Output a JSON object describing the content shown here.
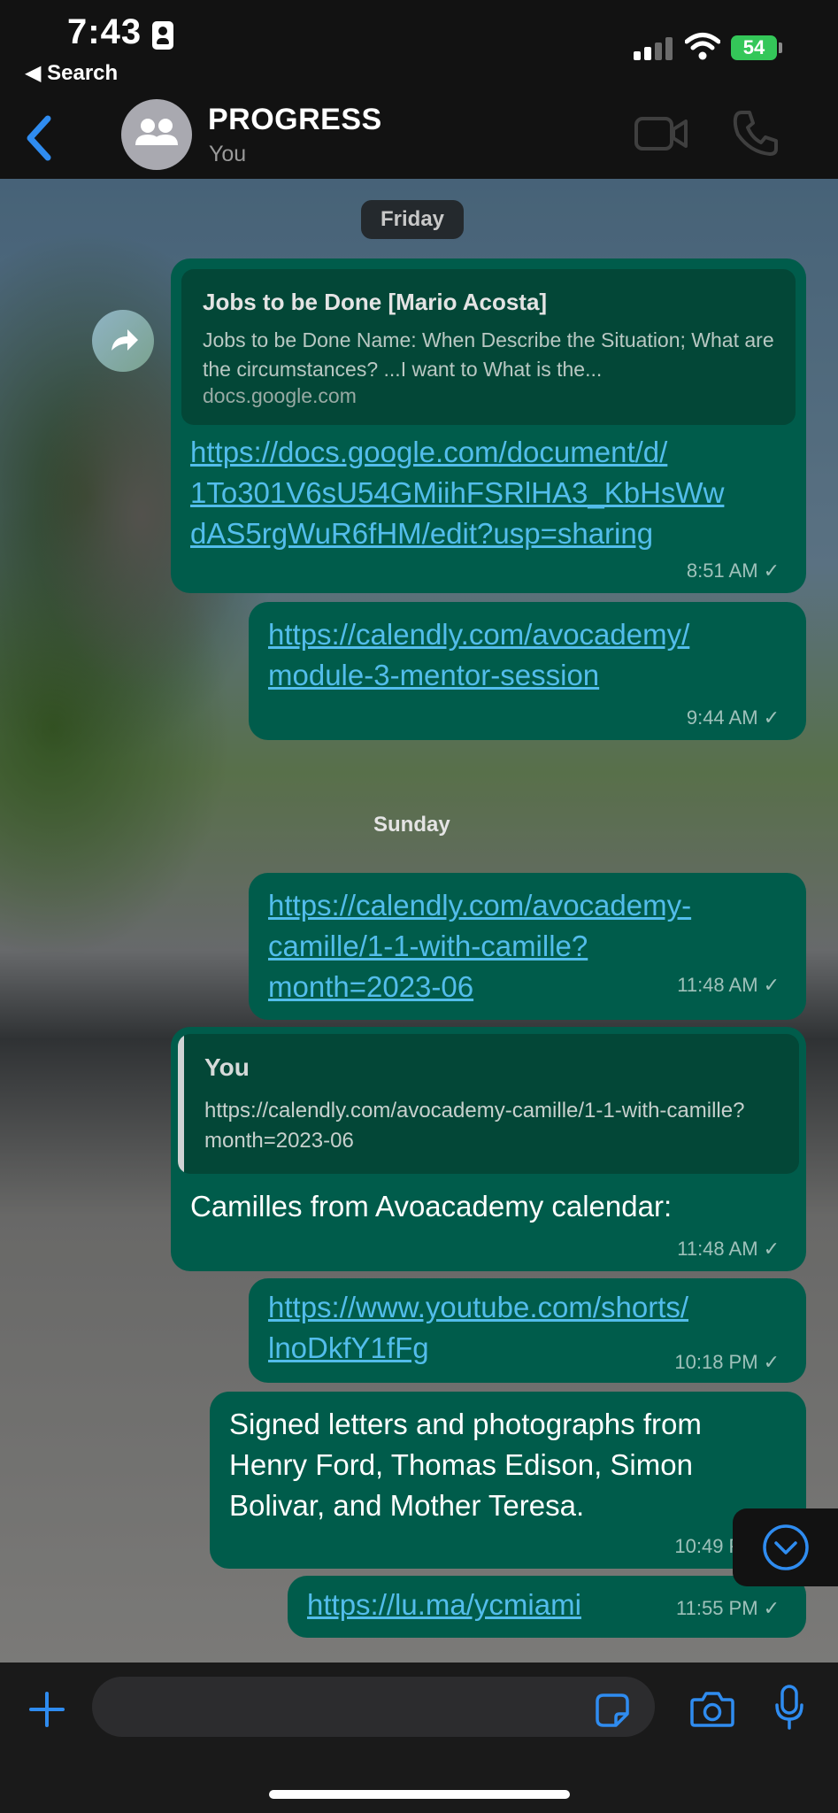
{
  "status_bar": {
    "time": "7:43",
    "back_app": "◀ Search",
    "battery": "54"
  },
  "header": {
    "title": "PROGRESS",
    "subtitle": "You"
  },
  "chat": {
    "day_friday": "Friday",
    "day_sunday": "Sunday",
    "messages": [
      {
        "preview_title": "Jobs to be Done [Mario Acosta]",
        "preview_desc": "Jobs to be Done Name:   When Describe the Situation; What are the circumstances? ...I want to What is the...",
        "preview_domain": "docs.google.com",
        "link_line1": "https://docs.google.com/document/d/",
        "link_line2": "1To301V6sU54GMiihFSRlHA3_KbHsWw",
        "link_line3": "dAS5rgWuR6fHM/edit?usp=sharing",
        "time": "8:51 AM"
      },
      {
        "link_line1": "https://calendly.com/avocademy/",
        "link_line2": "module-3-mentor-session",
        "time": "9:44 AM"
      },
      {
        "link_line1": "https://calendly.com/avocademy-",
        "link_line2": "camille/1-1-with-camille?",
        "link_line3": "month=2023-06",
        "time": "11:48 AM"
      },
      {
        "quote_author": "You",
        "quote_text": "https://calendly.com/avocademy-camille/1-1-with-camille?month=2023-06",
        "text": "Camilles from Avoacademy calendar:",
        "time": "11:48 AM"
      },
      {
        "link_line1": "https://www.youtube.com/shorts/",
        "link_line2": "lnoDkfY1fFg",
        "time": "10:18 PM"
      },
      {
        "text_line1": "Signed letters and photographs from",
        "text_line2": "Henry Ford, Thomas Edison, Simon",
        "text_line3": "Bolivar, and Mother Teresa.",
        "time": "10:49 PM"
      },
      {
        "link": "https://lu.ma/ycmiami",
        "time": "11:55 PM"
      }
    ]
  },
  "colors": {
    "bubble": "#005c4b",
    "link": "#53bdeb",
    "accent": "#2f8cf0",
    "battery": "#34c759"
  },
  "icons": [
    "id-badge-icon",
    "signal-icon",
    "wifi-icon",
    "battery-icon",
    "back-chevron-icon",
    "group-avatar-icon",
    "video-call-icon",
    "phone-icon",
    "forward-icon",
    "read-check-icon",
    "scroll-down-icon",
    "plus-icon",
    "sticker-icon",
    "camera-icon",
    "microphone-icon"
  ]
}
